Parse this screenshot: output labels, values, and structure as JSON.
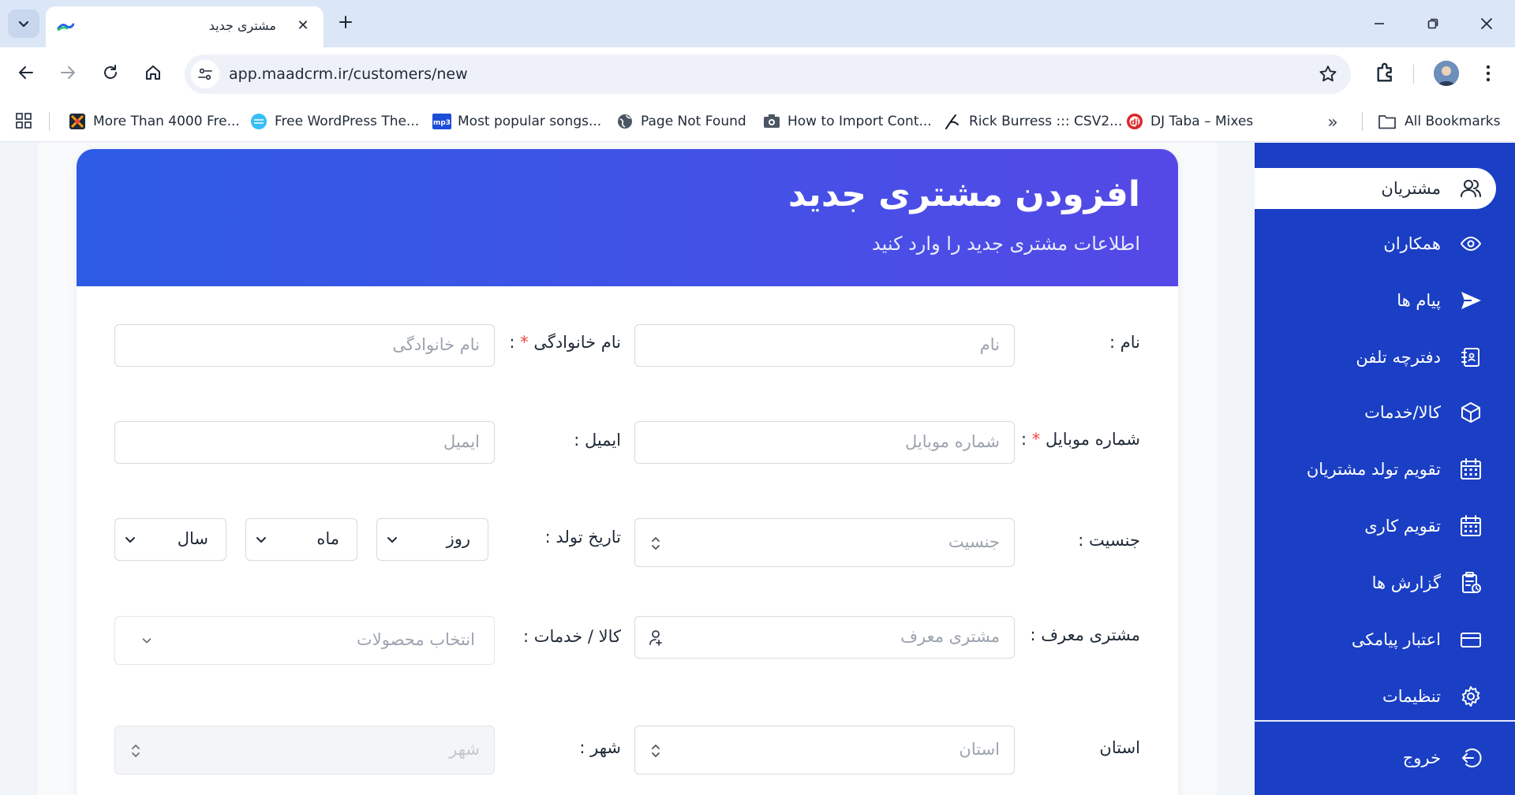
{
  "browser": {
    "tab_title": "مشتری جدید",
    "url": "app.maadcrm.ir/customers/new",
    "bookmarks": [
      {
        "label": "More Than 4000 Fre...",
        "icon": "colorful-puzzle-icon"
      },
      {
        "label": "Free WordPress The...",
        "icon": "globe-blue-icon"
      },
      {
        "label": "Most popular songs...",
        "icon": "mp3-icon"
      },
      {
        "label": "Page Not Found",
        "icon": "globe-icon"
      },
      {
        "label": "How to Import Cont...",
        "icon": "camera-icon"
      },
      {
        "label": "Rick Burress ::: CSV2...",
        "icon": "pen-icon"
      },
      {
        "label": "DJ Taba – Mixes",
        "icon": "dj-icon"
      }
    ],
    "all_bookmarks": "All Bookmarks"
  },
  "form": {
    "title": "افزودن مشتری جدید",
    "subtitle": "اطلاعات مشتری جدید را وارد کنید",
    "first_name": {
      "label": "نام :",
      "placeholder": "نام"
    },
    "last_name": {
      "label": "نام خانوادگی",
      "required_mark": "*",
      "suffix": " :",
      "placeholder": "نام خانوادگی"
    },
    "mobile": {
      "label": "شماره موبایل",
      "required_mark": "*",
      "suffix": " :",
      "placeholder": "شماره موبایل"
    },
    "email": {
      "label": "ایمیل :",
      "placeholder": "ایمیل"
    },
    "gender": {
      "label": "جنسیت :",
      "placeholder": "جنسیت"
    },
    "birth_date": {
      "label": "تاریخ تولد :",
      "day": "روز",
      "month": "ماه",
      "year": "سال"
    },
    "referrer": {
      "label": "مشتری معرف :",
      "placeholder": "مشتری معرف"
    },
    "products": {
      "label": "کالا / خدمات :",
      "placeholder": "انتخاب محصولات"
    },
    "province": {
      "label": "استان",
      "placeholder": "استان"
    },
    "city": {
      "label": "شهر :",
      "placeholder": "شهر"
    }
  },
  "sidebar": {
    "items": [
      {
        "label": "مشتریان",
        "icon": "users-icon",
        "active": true
      },
      {
        "label": "همکاران",
        "icon": "eye-icon"
      },
      {
        "label": "پیام ها",
        "icon": "send-icon"
      },
      {
        "label": "دفترچه تلفن",
        "icon": "address-book-icon"
      },
      {
        "label": "کالا/خدمات",
        "icon": "box-icon"
      },
      {
        "label": "تقویم تولد مشتریان",
        "icon": "calendar-icon"
      },
      {
        "label": "تقویم کاری",
        "icon": "calendar-icon"
      },
      {
        "label": "گزارش ها",
        "icon": "clipboard-icon"
      },
      {
        "label": "اعتبار پیامکی",
        "icon": "credit-card-icon"
      },
      {
        "label": "تنظیمات",
        "icon": "gear-icon"
      }
    ],
    "logout": {
      "label": "خروج",
      "icon": "logout-icon"
    }
  },
  "colors": {
    "sidebar_bg": "#1a3fc4",
    "header_gradient_start": "#2d5be4",
    "header_gradient_end": "#5548e6",
    "required": "#ef4444"
  }
}
